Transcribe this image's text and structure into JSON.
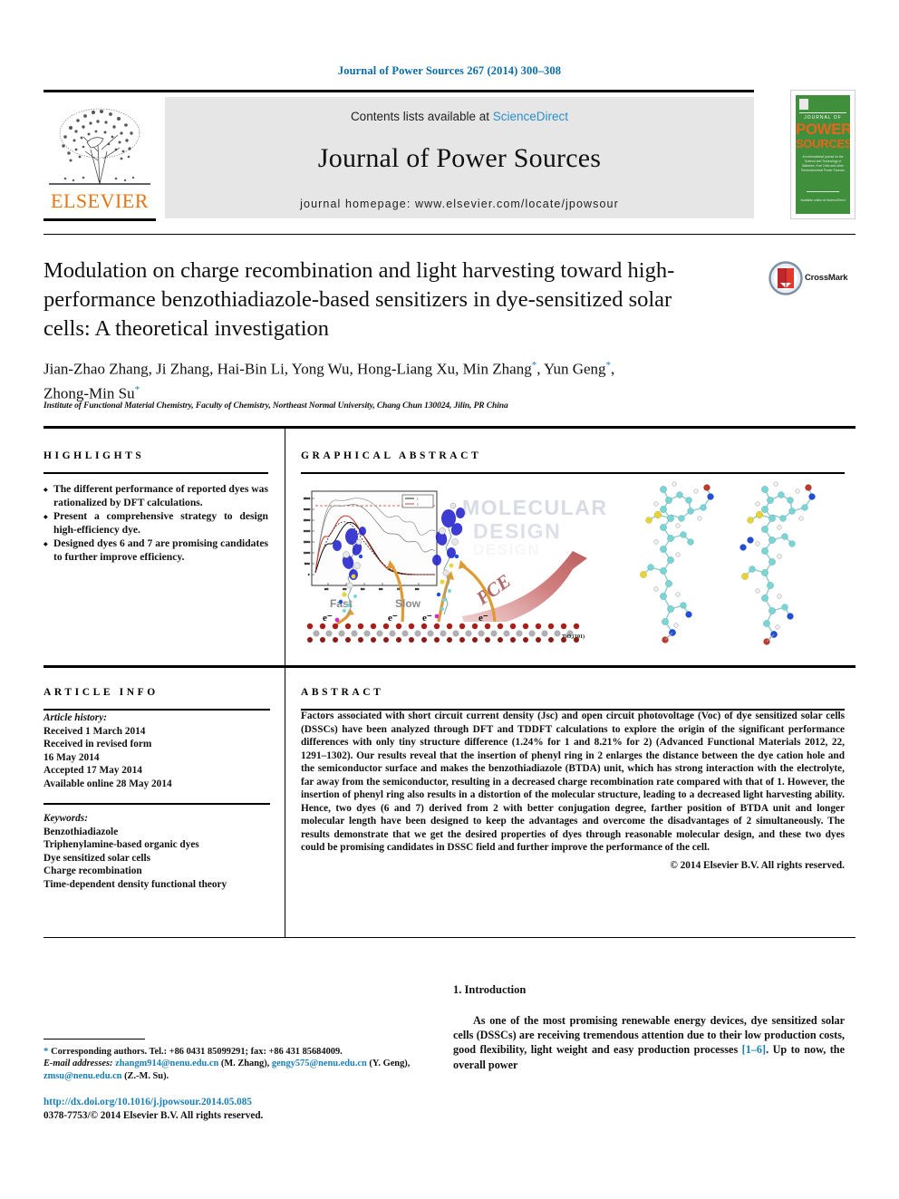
{
  "running_head": "Journal of Power Sources 267 (2014) 300–308",
  "masthead": {
    "contents_prefix": "Contents lists available at ",
    "sciencedirect": "ScienceDirect",
    "journal_title": "Journal of Power Sources",
    "homepage": "journal homepage: www.elsevier.com/locate/jpowsour",
    "publisher_wordmark": "ELSEVIER",
    "cover": {
      "line_journal_of": "JOURNAL OF",
      "line_power": "POWER",
      "line_sources": "SOURCES",
      "subtitle": "An international journal on the Science and Technology of Batteries, Fuel Cells and other Electrochemical Power Sources",
      "footer": "Available online at ScienceDirect"
    }
  },
  "article": {
    "title": "Modulation on charge recombination and light harvesting toward high-performance benzothiadiazole-based sensitizers in dye-sensitized solar cells: A theoretical investigation",
    "authors_line1": "Jian-Zhao Zhang, Ji Zhang, Hai-Bin Li, Yong Wu, Hong-Liang Xu, Min Zhang",
    "authors_line1b": ", Yun Geng",
    "authors_line2": "Zhong-Min Su",
    "affiliation": "Institute of Functional Material Chemistry, Faculty of Chemistry, Northeast Normal University, Chang Chun 130024, Jilin, PR China",
    "crossmark_label": "CrossMark"
  },
  "sections": {
    "highlights_heading": "HIGHLIGHTS",
    "graphical_abstract_heading": "GRAPHICAL ABSTRACT",
    "article_info_heading": "ARTICLE INFO",
    "abstract_heading": "ABSTRACT"
  },
  "highlights": [
    "The different performance of reported dyes was rationalized by DFT calculations.",
    "Present a comprehensive strategy to design high-efficiency dye.",
    "Designed dyes 6 and 7 are promising candidates to further improve efficiency."
  ],
  "graphical_abstract": {
    "watermark_line1": "MOLECULAR",
    "watermark_line2": "DESIGN",
    "pce_label": "PCE",
    "fast_label": "Fast",
    "slow_label": "Slow",
    "electron_label": "e⁻",
    "substrate_label": "TiO₂(101)",
    "legend": [
      "1",
      "2"
    ],
    "inset_axis_note": "absorption spectra"
  },
  "article_info": {
    "history_label": "Article history:",
    "history": [
      "Received 1 March 2014",
      "Received in revised form",
      "16 May 2014",
      "Accepted 17 May 2014",
      "Available online 28 May 2014"
    ],
    "keywords_label": "Keywords:",
    "keywords": [
      "Benzothiadiazole",
      "Triphenylamine-based organic dyes",
      "Dye sensitized solar cells",
      "Charge recombination",
      "Time-dependent density functional theory"
    ]
  },
  "abstract": {
    "text": "Factors associated with short circuit current density (Jsc) and open circuit photovoltage (Voc) of dye sensitized solar cells (DSSCs) have been analyzed through DFT and TDDFT calculations to explore the origin of the significant performance differences with only tiny structure difference (1.24% for 1 and 8.21% for 2) (Advanced Functional Materials 2012, 22, 1291–1302). Our results reveal that the insertion of phenyl ring in 2 enlarges the distance between the dye cation hole and the semiconductor surface and makes the benzothiadiazole (BTDA) unit, which has strong interaction with the electrolyte, far away from the semiconductor, resulting in a decreased charge recombination rate compared with that of 1. However, the insertion of phenyl ring also results in a distortion of the molecular structure, leading to a decreased light harvesting ability. Hence, two dyes (6 and 7) derived from 2 with better conjugation degree, farther position of BTDA unit and longer molecular length have been designed to keep the advantages and overcome the disadvantages of 2 simultaneously. The results demonstrate that we get the desired properties of dyes through reasonable molecular design, and these two dyes could be promising candidates in DSSC field and further improve the performance of the cell.",
    "copyright": "© 2014 Elsevier B.V. All rights reserved."
  },
  "introduction": {
    "heading": "1. Introduction",
    "paragraph_part1": "As one of the most promising renewable energy devices, dye sensitized solar cells (DSSCs) are receiving tremendous attention due to their low production costs, good flexibility, light weight and easy production processes ",
    "citation": "[1–6]",
    "paragraph_part2": ". Up to now, the overall power"
  },
  "footnote": {
    "corresponding": "Corresponding authors. Tel.: +86 0431 85099291; fax: +86 431 85684009.",
    "email_label": "E-mail addresses:",
    "email1": "zhangm914@nenu.edu.cn",
    "email1_attr": " (M. Zhang), ",
    "email2": "gengy575@nenu.edu.cn",
    "email2_attr": " (Y. Geng), ",
    "email3": "zmsu@nenu.edu.cn",
    "email3_attr": " (Z.-M. Su).",
    "doi": "http://dx.doi.org/10.1016/j.jpowsour.2014.05.085",
    "issn_line": "0378-7753/© 2014 Elsevier B.V. All rights reserved."
  },
  "colors": {
    "link_blue": "#1a7fb5",
    "sciencedirect_blue": "#2b8fc9",
    "elsevier_orange": "#E87511",
    "cover_green": "#3f8f3c",
    "cover_orange": "#e9641c"
  }
}
